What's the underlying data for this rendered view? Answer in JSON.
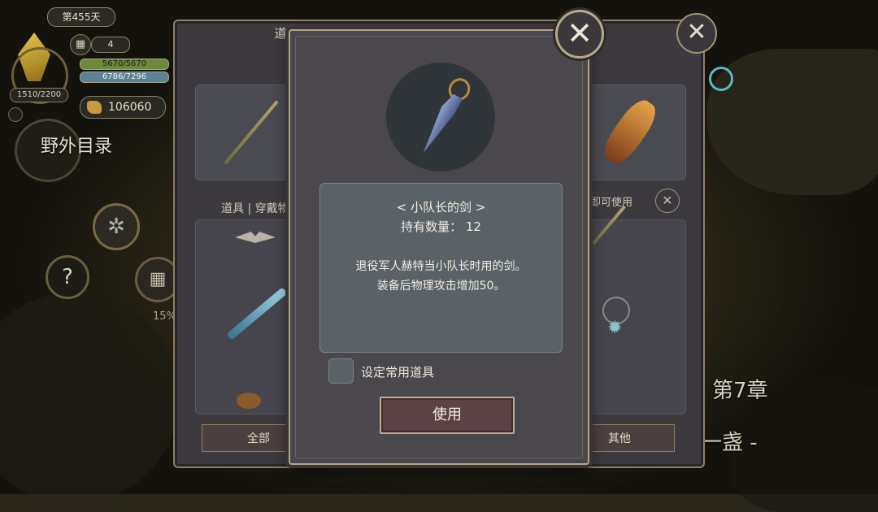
{
  "hud": {
    "day": "第455天",
    "calendar_count": "4",
    "exp": "1510/2200",
    "hp": "5670/5670",
    "mp": "6786/7296",
    "gold": "106060",
    "field_menu_label": "野外目录",
    "progress_percent": "15%",
    "chapter": "第7章",
    "chapter_subtitle": "岳一盏 -"
  },
  "back_panel": {
    "title": "道具保险箱",
    "tab_label": "道具 | 穿戴物",
    "hint": "道具即可使用",
    "categories": [
      "全部",
      "其他"
    ]
  },
  "dialog": {
    "item_name": "< 小队长的剑 >",
    "quantity": "持有数量： 12",
    "description_line1": "退役军人赫特当小队长时用的剑。",
    "description_line2": "装备后物理攻击增加50。",
    "checkbox_label": "设定常用道具",
    "use_button": "使用"
  },
  "icons": {
    "close": "close-icon",
    "calendar": "calendar-icon",
    "gold": "gold-icon",
    "gear": "gear-icon",
    "help": "help-icon"
  }
}
